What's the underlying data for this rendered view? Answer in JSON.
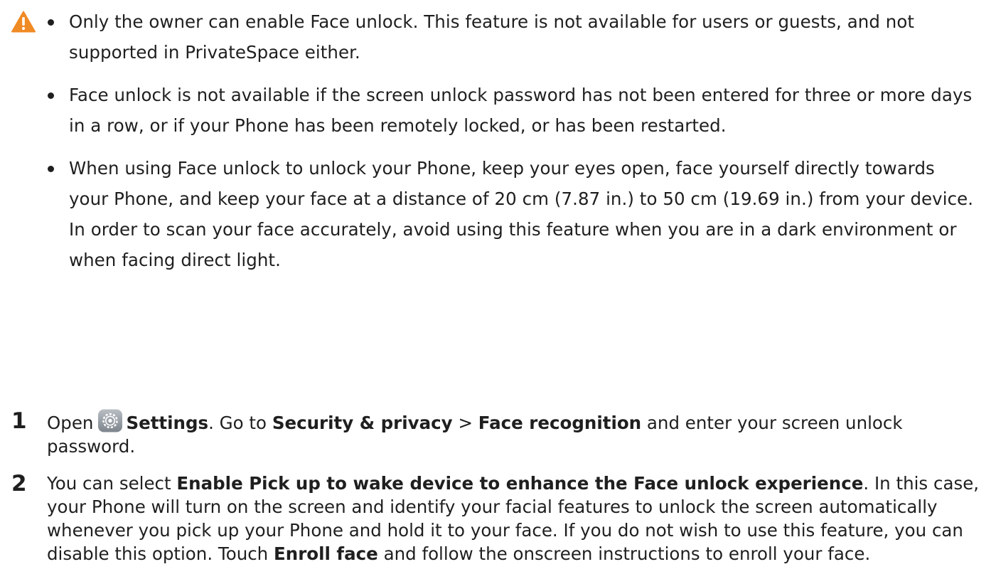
{
  "warning_note": {
    "icon": "warning-triangle-icon",
    "icon_color": "#f08a24",
    "items": [
      "Only the owner can enable Face unlock. This feature is not available for users or guests, and not supported in PrivateSpace either.",
      "Face unlock is not available if the screen unlock password has not been entered for three or more days in a row, or if your Phone has been remotely locked, or has been restarted.",
      "When using Face unlock to unlock your Phone, keep your eyes open, face yourself directly towards your Phone, and keep your face at a distance of 20 cm (7.87 in.) to 50 cm (19.69 in.) from your device. In order to scan your face accurately, avoid using this feature when you are in a dark environment or when facing direct light."
    ]
  },
  "steps": [
    {
      "number": "1",
      "open": "Open",
      "settings_icon": "settings-gear-icon",
      "settings": "Settings",
      "goto": ". Go to",
      "path1": "Security & privacy",
      "sep": ">",
      "path2": "Face recognition",
      "rest": "and enter your screen unlock password."
    },
    {
      "number": "2",
      "pre": "You can select",
      "option": "Enable Pick up to wake device to enhance the Face unlock experience",
      "mid": ". In this case, your Phone will turn on the screen and identify your facial features to unlock the screen automatically whenever you pick up your Phone and hold it to your face. If you do not wish to use this feature, you can disable this option. Touch",
      "action": "Enroll face",
      "post": "and follow the onscreen instructions to enroll your face."
    }
  ]
}
